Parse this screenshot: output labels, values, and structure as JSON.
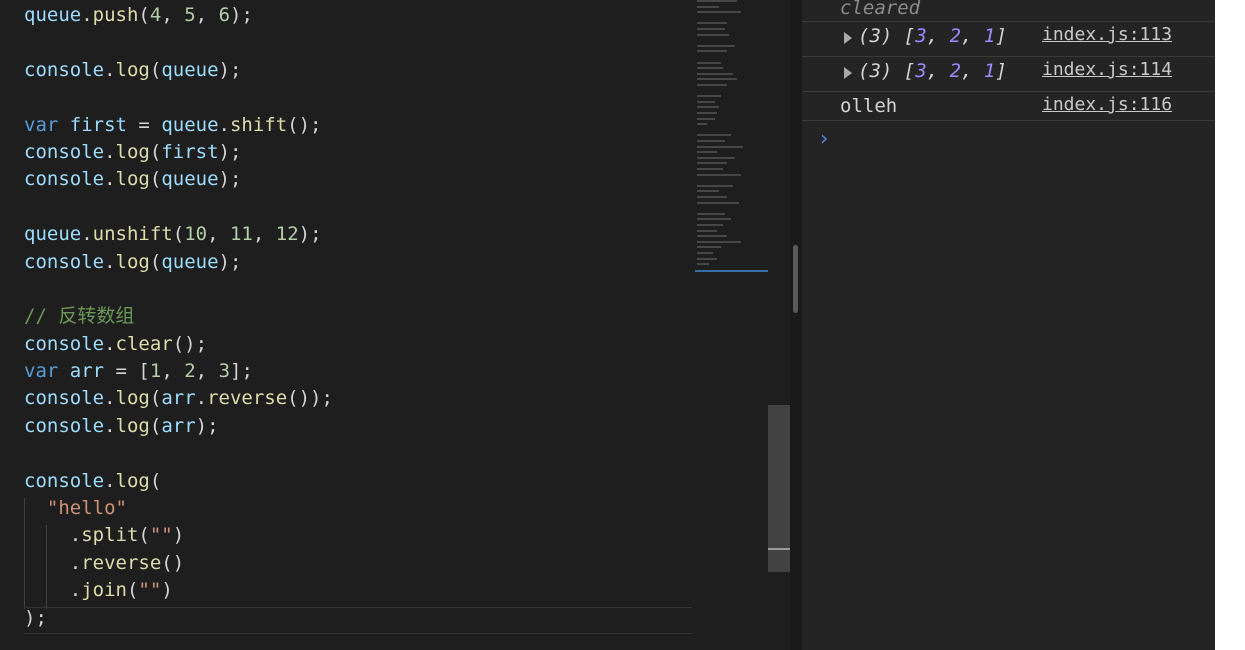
{
  "editor": {
    "lines": [
      {
        "tokens": [
          [
            "t-obj",
            "queue"
          ],
          [
            "t-p",
            "."
          ],
          [
            "t-fn",
            "push"
          ],
          [
            "t-p",
            "("
          ],
          [
            "t-num",
            "4"
          ],
          [
            "t-p",
            ", "
          ],
          [
            "t-num",
            "5"
          ],
          [
            "t-p",
            ", "
          ],
          [
            "t-num",
            "6"
          ],
          [
            "t-p",
            ");"
          ]
        ]
      },
      {
        "tokens": []
      },
      {
        "tokens": [
          [
            "t-obj",
            "console"
          ],
          [
            "t-p",
            "."
          ],
          [
            "t-fn",
            "log"
          ],
          [
            "t-p",
            "("
          ],
          [
            "t-obj",
            "queue"
          ],
          [
            "t-p",
            ");"
          ]
        ]
      },
      {
        "tokens": []
      },
      {
        "tokens": [
          [
            "t-kw",
            "var"
          ],
          [
            "t-p",
            " "
          ],
          [
            "t-obj",
            "first"
          ],
          [
            "t-p",
            " = "
          ],
          [
            "t-obj",
            "queue"
          ],
          [
            "t-p",
            "."
          ],
          [
            "t-fn",
            "shift"
          ],
          [
            "t-p",
            "();"
          ]
        ]
      },
      {
        "tokens": [
          [
            "t-obj",
            "console"
          ],
          [
            "t-p",
            "."
          ],
          [
            "t-fn",
            "log"
          ],
          [
            "t-p",
            "("
          ],
          [
            "t-obj",
            "first"
          ],
          [
            "t-p",
            ");"
          ]
        ]
      },
      {
        "tokens": [
          [
            "t-obj",
            "console"
          ],
          [
            "t-p",
            "."
          ],
          [
            "t-fn",
            "log"
          ],
          [
            "t-p",
            "("
          ],
          [
            "t-obj",
            "queue"
          ],
          [
            "t-p",
            ");"
          ]
        ]
      },
      {
        "tokens": []
      },
      {
        "tokens": [
          [
            "t-obj",
            "queue"
          ],
          [
            "t-p",
            "."
          ],
          [
            "t-fn",
            "unshift"
          ],
          [
            "t-p",
            "("
          ],
          [
            "t-num",
            "10"
          ],
          [
            "t-p",
            ", "
          ],
          [
            "t-num",
            "11"
          ],
          [
            "t-p",
            ", "
          ],
          [
            "t-num",
            "12"
          ],
          [
            "t-p",
            ");"
          ]
        ]
      },
      {
        "tokens": [
          [
            "t-obj",
            "console"
          ],
          [
            "t-p",
            "."
          ],
          [
            "t-fn",
            "log"
          ],
          [
            "t-p",
            "("
          ],
          [
            "t-obj",
            "queue"
          ],
          [
            "t-p",
            ");"
          ]
        ]
      },
      {
        "tokens": []
      },
      {
        "tokens": [
          [
            "t-cm",
            "// 反转数组"
          ]
        ]
      },
      {
        "tokens": [
          [
            "t-obj",
            "console"
          ],
          [
            "t-p",
            "."
          ],
          [
            "t-fn",
            "clear"
          ],
          [
            "t-p",
            "();"
          ]
        ]
      },
      {
        "tokens": [
          [
            "t-kw",
            "var"
          ],
          [
            "t-p",
            " "
          ],
          [
            "t-obj",
            "arr"
          ],
          [
            "t-p",
            " = ["
          ],
          [
            "t-num",
            "1"
          ],
          [
            "t-p",
            ", "
          ],
          [
            "t-num",
            "2"
          ],
          [
            "t-p",
            ", "
          ],
          [
            "t-num",
            "3"
          ],
          [
            "t-p",
            "];"
          ]
        ]
      },
      {
        "tokens": [
          [
            "t-obj",
            "console"
          ],
          [
            "t-p",
            "."
          ],
          [
            "t-fn",
            "log"
          ],
          [
            "t-p",
            "("
          ],
          [
            "t-obj",
            "arr"
          ],
          [
            "t-p",
            "."
          ],
          [
            "t-fn",
            "reverse"
          ],
          [
            "t-p",
            "());"
          ]
        ]
      },
      {
        "tokens": [
          [
            "t-obj",
            "console"
          ],
          [
            "t-p",
            "."
          ],
          [
            "t-fn",
            "log"
          ],
          [
            "t-p",
            "("
          ],
          [
            "t-obj",
            "arr"
          ],
          [
            "t-p",
            ");"
          ]
        ]
      },
      {
        "tokens": []
      },
      {
        "tokens": [
          [
            "t-obj",
            "console"
          ],
          [
            "t-p",
            "."
          ],
          [
            "t-fn",
            "log"
          ],
          [
            "t-p",
            "("
          ]
        ]
      },
      {
        "tokens": [
          [
            "t-p",
            "  "
          ],
          [
            "t-str",
            "\"hello\""
          ]
        ]
      },
      {
        "tokens": [
          [
            "t-p",
            "    ."
          ],
          [
            "t-fn",
            "split"
          ],
          [
            "t-p",
            "("
          ],
          [
            "t-str",
            "\"\""
          ],
          [
            "t-p",
            ")"
          ]
        ]
      },
      {
        "tokens": [
          [
            "t-p",
            "    ."
          ],
          [
            "t-fn",
            "reverse"
          ],
          [
            "t-p",
            "()"
          ]
        ]
      },
      {
        "tokens": [
          [
            "t-p",
            "    ."
          ],
          [
            "t-fn",
            "join"
          ],
          [
            "t-p",
            "("
          ],
          [
            "t-str",
            "\"\""
          ],
          [
            "t-p",
            ")"
          ]
        ]
      },
      {
        "tokens": [
          [
            "t-p",
            ");"
          ]
        ]
      }
    ]
  },
  "console": {
    "cleared_text": "cleared",
    "entries": [
      {
        "count": "(3)",
        "open": "[",
        "items": [
          "3",
          "2",
          "1"
        ],
        "close": "]",
        "source": "index.js:113"
      },
      {
        "count": "(3)",
        "open": "[",
        "items": [
          "3",
          "2",
          "1"
        ],
        "close": "]",
        "source": "index.js:114"
      }
    ],
    "string_entry": {
      "text": "olleh",
      "source": "index.js:116"
    },
    "prompt_symbol": "›"
  }
}
